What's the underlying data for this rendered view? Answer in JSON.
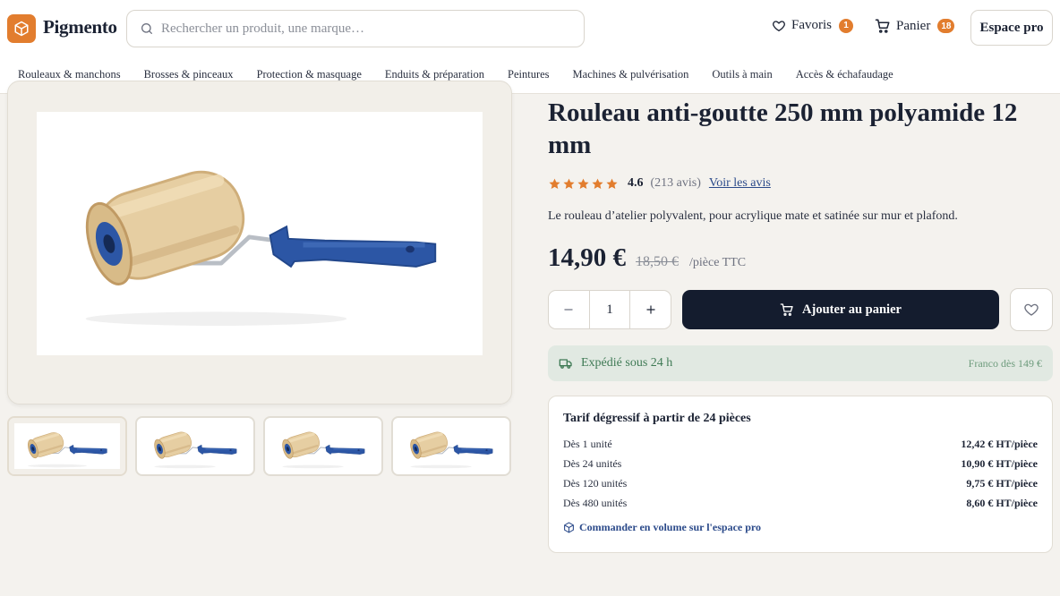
{
  "header": {
    "brand": "Pigmento",
    "search_placeholder": "Rechercher un produit, une marque…",
    "favorites_label": "Favoris",
    "favorites_count": "1",
    "cart_label": "Panier",
    "cart_count": "18",
    "pro_label": "Espace pro"
  },
  "nav": {
    "items": [
      "Rouleaux & manchons",
      "Brosses & pinceaux",
      "Protection & masquage",
      "Enduits & préparation",
      "Peintures",
      "Machines & pulvérisation",
      "Outils à main",
      "Accès & échafaudage"
    ]
  },
  "product": {
    "title": "Rouleau anti-goutte 250 mm polyamide 12 mm",
    "rating_value": 4.6,
    "rating_text": "4.6",
    "reviews_count": "(213 avis)",
    "reviews_link": "Voir les avis",
    "description": "Le rouleau d’atelier polyvalent, pour acrylique mate et satinée sur mur et plafond.",
    "price": "14,90 €",
    "old_price": "18,50 €",
    "price_unit": "/pièce TTC",
    "quantity": "1",
    "add_to_cart": "Ajouter au panier"
  },
  "shipping": {
    "text": "Expédié sous 24 h",
    "franco": "Franco dès 149 €"
  },
  "tiers": {
    "title": "Tarif dégressif à partir de 24 pièces",
    "rows": [
      {
        "label": "Dès 1 unité",
        "value": "12,42 € HT/pièce"
      },
      {
        "label": "Dès 24 unités",
        "value": "10,90 € HT/pièce"
      },
      {
        "label": "Dès 120 unités",
        "value": "9,75 € HT/pièce"
      },
      {
        "label": "Dès 480 unités",
        "value": "8,60 € HT/pièce"
      }
    ],
    "link": "Commander en volume sur l'espace pro"
  },
  "colors": {
    "accent": "#e27d2e",
    "primary": "#141c2e",
    "link": "#2b4a8a",
    "success": "#3f7a55"
  },
  "icons": [
    "box-icon",
    "search-icon",
    "heart-icon",
    "cart-icon",
    "minus-icon",
    "plus-icon",
    "truck-icon",
    "star-icon",
    "package-icon"
  ]
}
